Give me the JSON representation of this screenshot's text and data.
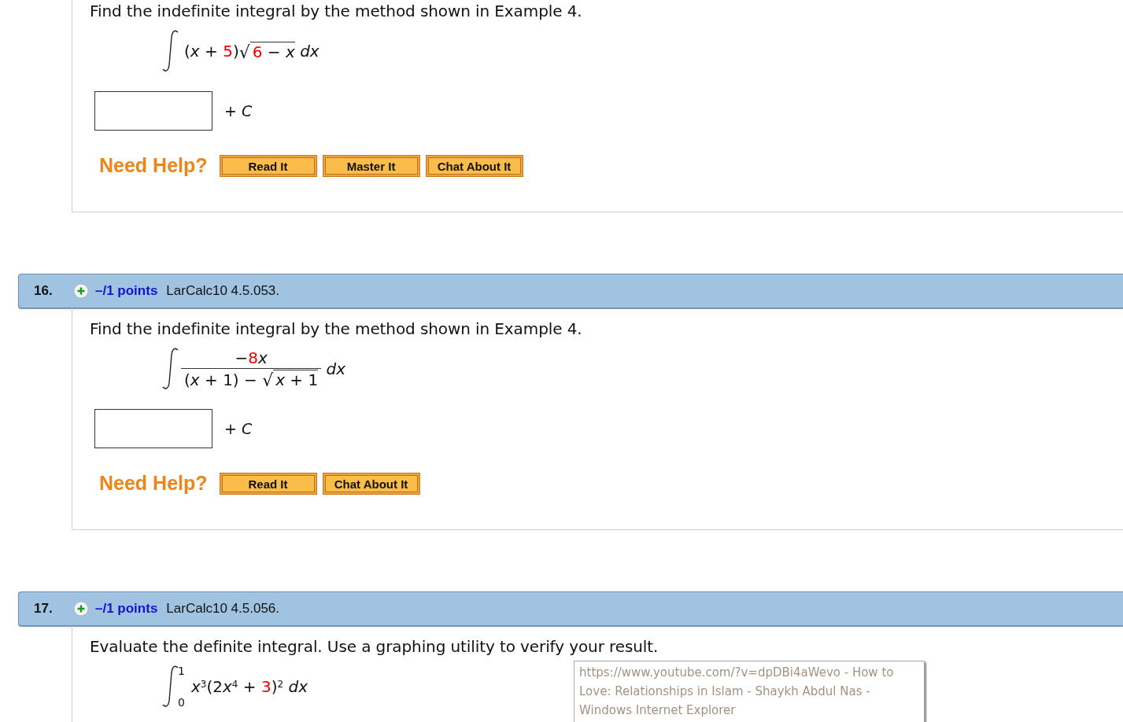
{
  "questions": [
    {
      "prompt": "Find the indefinite integral by the method shown in Example 4.",
      "integral": {
        "expression": [
          {
            "kind": "text",
            "text": "(*x* + "
          },
          {
            "kind": "given",
            "text": "5"
          },
          {
            "kind": "text",
            "text": ")"
          },
          {
            "kind": "sqrt",
            "symbol": "√",
            "body": [
              {
                "kind": "given",
                "text": "6"
              },
              {
                "kind": "text",
                "text": " − *x*"
              }
            ]
          },
          {
            "kind": "text",
            "text": " *dx*"
          }
        ]
      },
      "answer": {
        "suffix": "+ *C*"
      },
      "help": {
        "label": "Need Help?",
        "buttons": [
          "Read It",
          "Master It",
          "Chat About It"
        ]
      }
    },
    {
      "number": "16.",
      "points": "–/1 points",
      "source": "LarCalc10 4.5.053.",
      "prompt": "Find the indefinite integral by the method shown in Example 4.",
      "integral": {
        "expression": [
          {
            "kind": "frac",
            "num": [
              {
                "kind": "text",
                "text": "−"
              },
              {
                "kind": "given",
                "text": "8"
              },
              {
                "kind": "text",
                "text": "*x*"
              }
            ],
            "den": [
              {
                "kind": "text",
                "text": "(*x* + 1) − "
              },
              {
                "kind": "sqrt",
                "symbol": "√",
                "body": [
                  {
                    "kind": "text",
                    "text": "*x* + 1"
                  }
                ]
              }
            ]
          },
          {
            "kind": "text",
            "text": " *dx*"
          }
        ]
      },
      "answer": {
        "suffix": "+ *C*"
      },
      "help": {
        "label": "Need Help?",
        "buttons": [
          "Read It",
          "Chat About It"
        ]
      }
    },
    {
      "number": "17.",
      "points": "–/1 points",
      "source": "LarCalc10 4.5.056.",
      "prompt": "Evaluate the definite integral. Use a graphing utility to verify your result.",
      "integral": {
        "upper": "1",
        "lower": "0",
        "expression": [
          {
            "kind": "text",
            "text": "*x*"
          },
          {
            "kind": "sup",
            "text": "3"
          },
          {
            "kind": "text",
            "text": "(2"
          },
          {
            "kind": "var",
            "text": "x"
          },
          {
            "kind": "sup",
            "text": "4"
          },
          {
            "kind": "text",
            "text": " + "
          },
          {
            "kind": "given",
            "text": "3"
          },
          {
            "kind": "text",
            "text": ")"
          },
          {
            "kind": "sup",
            "text": "2"
          },
          {
            "kind": "text",
            "text": " *dx*"
          }
        ]
      }
    }
  ],
  "tooltip": {
    "text": "https://www.youtube.com/?v=dpDBi4aWevo - How to Love: Relationships in Islam - Shaykh Abdul Nas - Windows Internet Explorer"
  }
}
